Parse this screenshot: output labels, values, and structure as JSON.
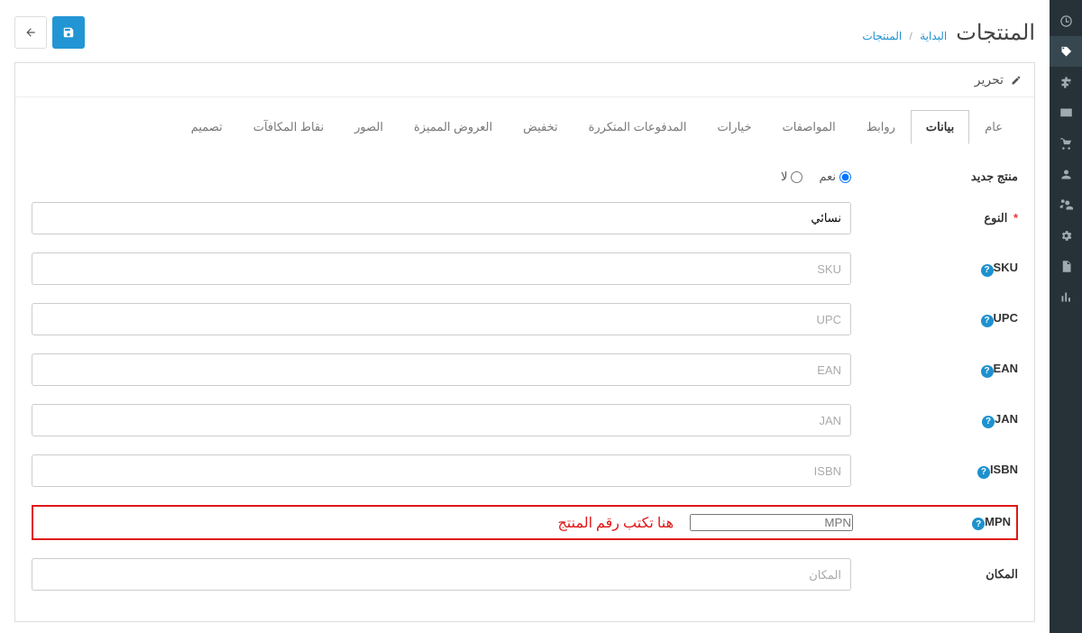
{
  "page_title": "المنتجات",
  "breadcrumb": {
    "home": "البداية",
    "current": "المنتجات"
  },
  "panel_head": "تحرير",
  "tabs": [
    "عام",
    "بيانات",
    "روابط",
    "المواصفات",
    "خيارات",
    "المدفوعات المتكررة",
    "تخفيض",
    "العروض المميزة",
    "الصور",
    "نقاط المكافآت",
    "تصميم"
  ],
  "labels": {
    "new_product": "منتج جديد",
    "yes": "نعم",
    "no": "لا",
    "type": "النوع",
    "sku": "SKU",
    "upc": "UPC",
    "ean": "EAN",
    "jan": "JAN",
    "isbn": "ISBN",
    "mpn": "MPN",
    "location": "المكان"
  },
  "values": {
    "type": "نسائي"
  },
  "placeholders": {
    "sku": "SKU",
    "upc": "UPC",
    "ean": "EAN",
    "jan": "JAN",
    "isbn": "ISBN",
    "mpn": "MPN",
    "location": "المكان"
  },
  "annotation": "هنا تكتب رقم المنتج"
}
